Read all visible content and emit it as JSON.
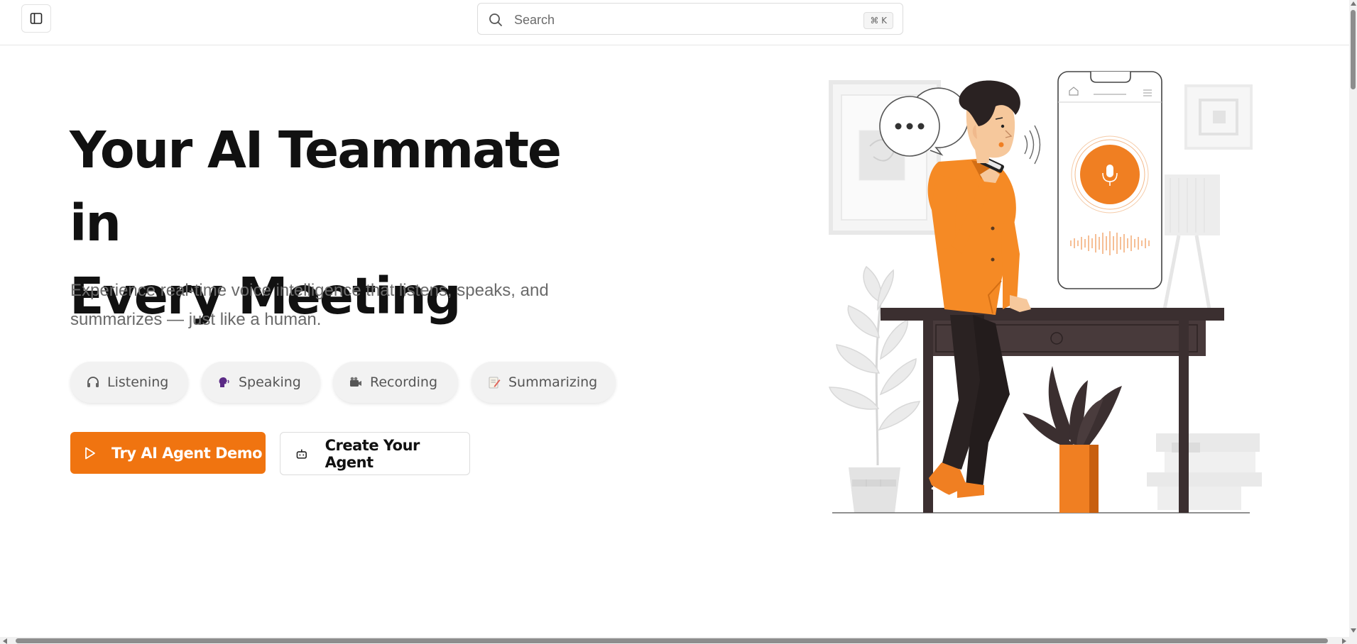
{
  "header": {
    "sidebar_toggle_icon": "sidebar-panel-icon",
    "search": {
      "placeholder": "Search",
      "shortcut": "⌘ K",
      "icon": "search-icon"
    }
  },
  "hero": {
    "title_line1": "Your AI Teammate in",
    "title_line2": "Every Meeting",
    "subtitle_line1": "Experience real-time voice intelligence that listens, speaks, and",
    "subtitle_line2": "summarizes — just like a human.",
    "chips": [
      {
        "label": "Listening",
        "icon": "headphones-icon"
      },
      {
        "label": "Speaking",
        "icon": "speaking-head-icon"
      },
      {
        "label": "Recording",
        "icon": "video-camera-icon"
      },
      {
        "label": "Summarizing",
        "icon": "memo-icon"
      }
    ],
    "primary_button": {
      "label": "Try AI Agent Demo",
      "icon": "play-icon"
    },
    "secondary_button": {
      "label": "Create Your Agent",
      "icon": "bot-icon"
    }
  },
  "colors": {
    "accent": "#f07410",
    "text": "#111111",
    "muted": "#6a6a6a",
    "illustration_dark": "#3b2f30"
  }
}
